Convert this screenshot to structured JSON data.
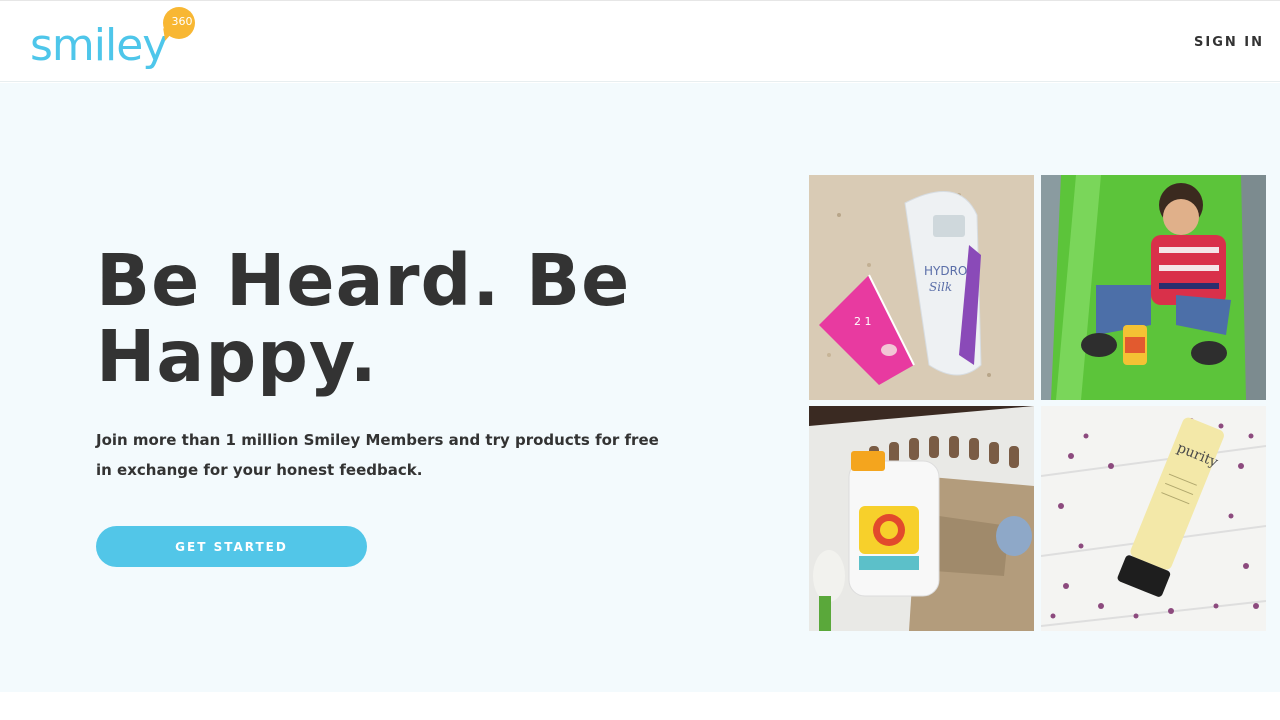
{
  "header": {
    "logo_text": "smiley",
    "logo_badge": "360",
    "signin_label": "SIGN IN"
  },
  "hero": {
    "headline": "Be Heard. Be Happy.",
    "subtext": "Join more than 1 million Smiley Members and try products for free in exchange for your honest feedback.",
    "cta_label": "GET STARTED"
  },
  "gallery": {
    "tiles": [
      {
        "label_a": "HYDRO",
        "label_b": "Silk",
        "label_c": "2 1"
      },
      {
        "label_a": ""
      },
      {
        "label_a": ""
      },
      {
        "label_a": "purity"
      }
    ]
  },
  "colors": {
    "brand_blue": "#4ec6ea",
    "badge_orange": "#f8b733",
    "cta_blue": "#52c6e8",
    "hero_bg": "#f3fafd",
    "text_dark": "#333333"
  }
}
